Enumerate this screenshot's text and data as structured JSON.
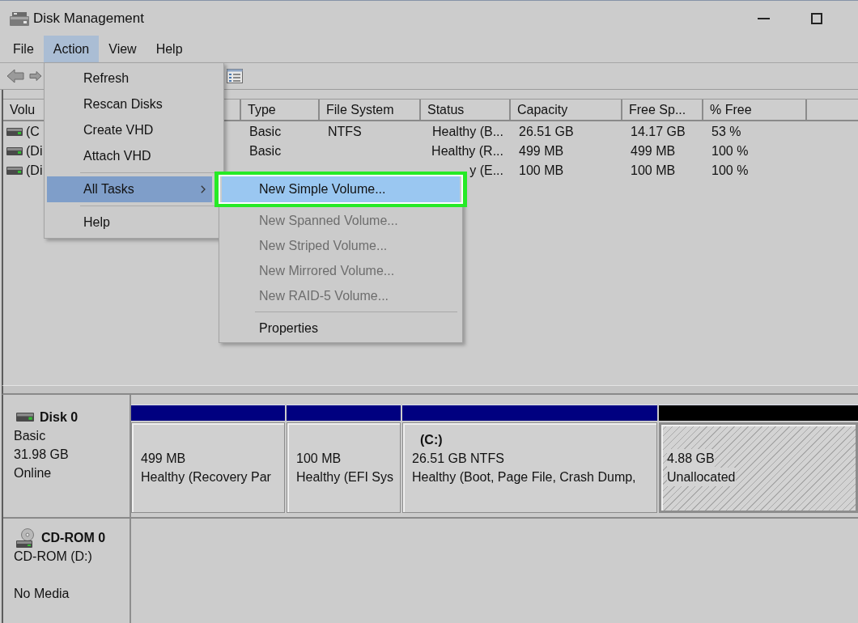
{
  "window": {
    "title": "Disk Management"
  },
  "menu_bar": [
    {
      "label": "File",
      "selected": false
    },
    {
      "label": "Action",
      "selected": true
    },
    {
      "label": "View",
      "selected": false
    },
    {
      "label": "Help",
      "selected": false
    }
  ],
  "volume_table": {
    "columns": [
      "Volu",
      "Type",
      "File System",
      "Status",
      "Capacity",
      "Free Sp...",
      "% Free"
    ],
    "rows": [
      {
        "volume": "(C",
        "type": "Basic",
        "file_system": "NTFS",
        "status": "Healthy (B...",
        "capacity": "26.51 GB",
        "free_space": "14.17 GB",
        "percent_free": "53 %"
      },
      {
        "volume": "(Di",
        "type": "Basic",
        "status": "Healthy (R...",
        "capacity": "499 MB",
        "free_space": "499 MB",
        "percent_free": "100 %"
      },
      {
        "volume": "(Di",
        "status": "y (E...",
        "capacity": "100 MB",
        "free_space": "100 MB",
        "percent_free": "100 %"
      }
    ]
  },
  "action_menu": [
    {
      "kind": "item",
      "label": "Refresh",
      "selected": false
    },
    {
      "kind": "item",
      "label": "Rescan Disks",
      "selected": false
    },
    {
      "kind": "item",
      "label": "Create VHD",
      "selected": false
    },
    {
      "kind": "item",
      "label": "Attach VHD",
      "selected": false
    },
    {
      "kind": "separator"
    },
    {
      "kind": "submenu",
      "label": "All Tasks",
      "selected": true
    },
    {
      "kind": "separator"
    },
    {
      "kind": "item",
      "label": "Help",
      "selected": false
    }
  ],
  "all_tasks_menu": [
    {
      "kind": "item",
      "label": "New Simple Volume...",
      "selected": true,
      "disabled": false,
      "outlined": true
    },
    {
      "kind": "item",
      "label": "New Spanned Volume...",
      "selected": false,
      "disabled": true,
      "outlined": false
    },
    {
      "kind": "item",
      "label": "New Striped Volume...",
      "selected": false,
      "disabled": true,
      "outlined": false
    },
    {
      "kind": "item",
      "label": "New Mirrored Volume...",
      "selected": false,
      "disabled": true,
      "outlined": false
    },
    {
      "kind": "item",
      "label": "New RAID-5 Volume...",
      "selected": false,
      "disabled": true,
      "outlined": false
    },
    {
      "kind": "separator"
    },
    {
      "kind": "item",
      "label": "Properties",
      "selected": false,
      "disabled": false,
      "outlined": false
    }
  ],
  "disks": [
    {
      "kind": "disk",
      "name": "Disk 0",
      "type": "Basic",
      "size": "31.98 GB",
      "status": "Online",
      "partitions": [
        {
          "kind": "primary",
          "size": "499 MB",
          "status": "Healthy (Recovery Par"
        },
        {
          "kind": "primary",
          "size": "100 MB",
          "status": "Healthy (EFI Sys"
        },
        {
          "kind": "primary",
          "volume": "(C:)",
          "size": "26.51 GB NTFS",
          "status": "Healthy (Boot, Page File, Crash Dump,"
        },
        {
          "kind": "unallocated",
          "size": "4.88 GB",
          "status": "Unallocated"
        }
      ]
    },
    {
      "kind": "cdrom",
      "name": "CD-ROM 0",
      "type": "CD-ROM (D:)",
      "status": "No Media"
    }
  ]
}
